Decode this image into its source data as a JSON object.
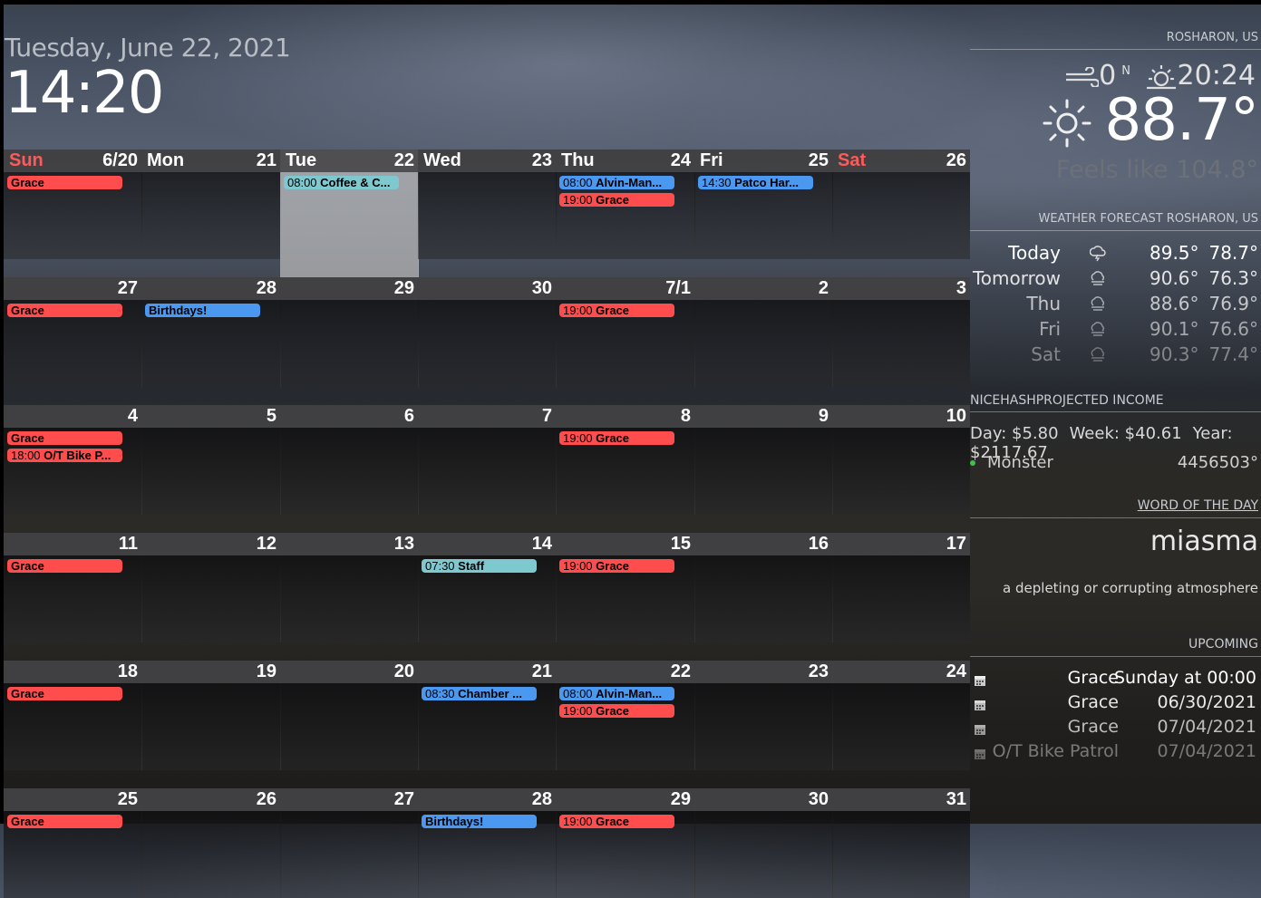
{
  "clock": {
    "date": "Tuesday, June 22, 2021",
    "time": "14:20"
  },
  "calendar": {
    "weeks": [
      {
        "days": [
          {
            "name": "Sun",
            "num": "6/20",
            "weekend": true,
            "events": [
              {
                "time": "",
                "title": "Grace",
                "color": "red"
              }
            ]
          },
          {
            "name": "Mon",
            "num": "21",
            "events": []
          },
          {
            "name": "Tue",
            "num": "22",
            "today": true,
            "events": [
              {
                "time": "08:00",
                "title": "Coffee & C...",
                "color": "teal"
              }
            ]
          },
          {
            "name": "Wed",
            "num": "23",
            "events": []
          },
          {
            "name": "Thu",
            "num": "24",
            "events": [
              {
                "time": "08:00",
                "title": "Alvin-Man...",
                "color": "blue"
              },
              {
                "time": "19:00",
                "title": "Grace",
                "color": "red"
              }
            ]
          },
          {
            "name": "Fri",
            "num": "25",
            "events": [
              {
                "time": "14:30",
                "title": "Patco Har...",
                "color": "blue"
              }
            ]
          },
          {
            "name": "Sat",
            "num": "26",
            "weekend": true,
            "events": []
          }
        ]
      },
      {
        "days": [
          {
            "name": "",
            "num": "27",
            "events": [
              {
                "time": "",
                "title": "Grace",
                "color": "red"
              }
            ]
          },
          {
            "name": "",
            "num": "28",
            "events": [
              {
                "time": "",
                "title": "Birthdays!",
                "color": "blue"
              }
            ]
          },
          {
            "name": "",
            "num": "29",
            "events": []
          },
          {
            "name": "",
            "num": "30",
            "events": []
          },
          {
            "name": "",
            "num": "7/1",
            "events": [
              {
                "time": "19:00",
                "title": "Grace",
                "color": "red"
              }
            ]
          },
          {
            "name": "",
            "num": "2",
            "events": []
          },
          {
            "name": "",
            "num": "3",
            "events": []
          }
        ]
      },
      {
        "days": [
          {
            "name": "",
            "num": "4",
            "events": [
              {
                "time": "",
                "title": "Grace",
                "color": "red"
              },
              {
                "time": "18:00",
                "title": "O/T Bike P...",
                "color": "red"
              }
            ]
          },
          {
            "name": "",
            "num": "5",
            "events": []
          },
          {
            "name": "",
            "num": "6",
            "events": []
          },
          {
            "name": "",
            "num": "7",
            "events": []
          },
          {
            "name": "",
            "num": "8",
            "events": [
              {
                "time": "19:00",
                "title": "Grace",
                "color": "red"
              }
            ]
          },
          {
            "name": "",
            "num": "9",
            "events": []
          },
          {
            "name": "",
            "num": "10",
            "events": []
          }
        ]
      },
      {
        "days": [
          {
            "name": "",
            "num": "11",
            "events": [
              {
                "time": "",
                "title": "Grace",
                "color": "red"
              }
            ]
          },
          {
            "name": "",
            "num": "12",
            "events": []
          },
          {
            "name": "",
            "num": "13",
            "events": []
          },
          {
            "name": "",
            "num": "14",
            "events": [
              {
                "time": "07:30",
                "title": "Staff",
                "color": "teal"
              }
            ]
          },
          {
            "name": "",
            "num": "15",
            "events": [
              {
                "time": "19:00",
                "title": "Grace",
                "color": "red"
              }
            ]
          },
          {
            "name": "",
            "num": "16",
            "events": []
          },
          {
            "name": "",
            "num": "17",
            "events": []
          }
        ]
      },
      {
        "days": [
          {
            "name": "",
            "num": "18",
            "events": [
              {
                "time": "",
                "title": "Grace",
                "color": "red"
              }
            ]
          },
          {
            "name": "",
            "num": "19",
            "events": []
          },
          {
            "name": "",
            "num": "20",
            "events": []
          },
          {
            "name": "",
            "num": "21",
            "events": [
              {
                "time": "08:30",
                "title": "Chamber ...",
                "color": "blue"
              }
            ]
          },
          {
            "name": "",
            "num": "22",
            "events": [
              {
                "time": "08:00",
                "title": "Alvin-Man...",
                "color": "blue"
              },
              {
                "time": "19:00",
                "title": "Grace",
                "color": "red"
              }
            ]
          },
          {
            "name": "",
            "num": "23",
            "events": []
          },
          {
            "name": "",
            "num": "24",
            "events": []
          }
        ]
      },
      {
        "days": [
          {
            "name": "",
            "num": "25",
            "events": [
              {
                "time": "",
                "title": "Grace",
                "color": "red"
              }
            ]
          },
          {
            "name": "",
            "num": "26",
            "events": []
          },
          {
            "name": "",
            "num": "27",
            "events": []
          },
          {
            "name": "",
            "num": "28",
            "events": [
              {
                "time": "",
                "title": "Birthdays!",
                "color": "blue"
              }
            ]
          },
          {
            "name": "",
            "num": "29",
            "events": [
              {
                "time": "19:00",
                "title": "Grace",
                "color": "red"
              }
            ]
          },
          {
            "name": "",
            "num": "30",
            "events": []
          },
          {
            "name": "",
            "num": "31",
            "events": []
          }
        ]
      }
    ]
  },
  "weather": {
    "location": "ROSHARON, US",
    "wind_speed": "0",
    "wind_dir": "N",
    "sunset": "20:24",
    "temp": "88.7°",
    "feels_like": "Feels like 104.8°",
    "icons": {
      "wind": "wind-icon",
      "sun": "sunset-icon",
      "current": "sun-icon"
    }
  },
  "forecast": {
    "title": "WEATHER FORECAST ROSHARON, US",
    "rows": [
      {
        "day": "Today",
        "icon": "thunderstorm-icon",
        "high": "89.5°",
        "low": "78.7°",
        "opacity": 1
      },
      {
        "day": "Tomorrow",
        "icon": "cloudy-wind-icon",
        "high": "90.6°",
        "low": "76.3°",
        "opacity": 0.85
      },
      {
        "day": "Thu",
        "icon": "cloudy-wind-icon",
        "high": "88.6°",
        "low": "76.9°",
        "opacity": 0.7
      },
      {
        "day": "Fri",
        "icon": "cloudy-wind-icon",
        "high": "90.1°",
        "low": "76.6°",
        "opacity": 0.55
      },
      {
        "day": "Sat",
        "icon": "cloudy-wind-icon",
        "high": "90.3°",
        "low": "77.4°",
        "opacity": 0.4
      }
    ]
  },
  "nicehash": {
    "title": "NICEHASHPROJECTED INCOME",
    "day": "Day: $5.80",
    "week": "Week: $40.61",
    "year": "Year: $2117.67",
    "rig_name": "Monster",
    "rig_value": "4456503°"
  },
  "word_of_day": {
    "title": "WORD OF THE DAY",
    "word": "miasma",
    "definition": "a depleting or corrupting atmosphere"
  },
  "upcoming": {
    "title": "UPCOMING",
    "rows": [
      {
        "title": "Grace",
        "when": "Sunday at 00:00",
        "opacity": 1
      },
      {
        "title": "Grace",
        "when": "06/30/2021",
        "opacity": 0.9
      },
      {
        "title": "Grace",
        "when": "07/04/2021",
        "opacity": 0.7
      },
      {
        "title": "O/T Bike Patrol",
        "when": "07/04/2021",
        "opacity": 0.4
      }
    ]
  }
}
